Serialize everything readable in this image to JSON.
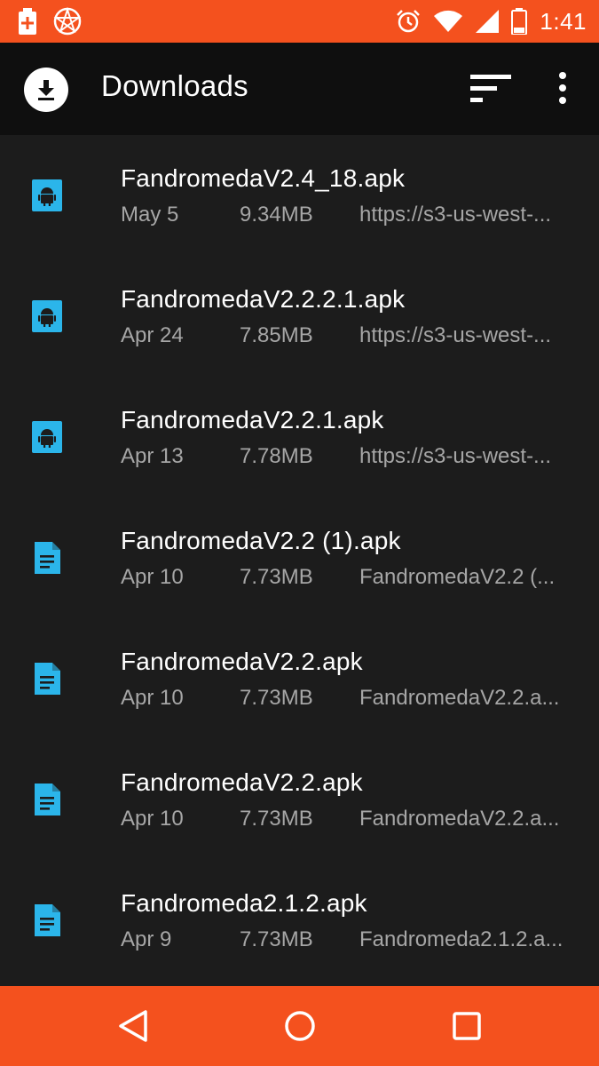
{
  "status_bar": {
    "time": "1:41",
    "icons": [
      "medical-kit-icon",
      "pentagram-icon",
      "alarm-icon",
      "wifi-icon",
      "signal-icon",
      "battery-icon"
    ],
    "color": "#f4511e"
  },
  "app_bar": {
    "title": "Downloads",
    "icon": "download-icon",
    "actions": [
      "sort-icon",
      "more-vert-icon"
    ]
  },
  "downloads": [
    {
      "name": "FandromedaV2.4_18.apk",
      "date": "May 5",
      "size": "9.34MB",
      "source": "https://s3-us-west-...",
      "icon": "android-icon"
    },
    {
      "name": "FandromedaV2.2.2.1.apk",
      "date": "Apr 24",
      "size": "7.85MB",
      "source": "https://s3-us-west-...",
      "icon": "android-icon"
    },
    {
      "name": "FandromedaV2.2.1.apk",
      "date": "Apr 13",
      "size": "7.78MB",
      "source": "https://s3-us-west-...",
      "icon": "android-icon"
    },
    {
      "name": "FandromedaV2.2 (1).apk",
      "date": "Apr 10",
      "size": "7.73MB",
      "source": "FandromedaV2.2 (...",
      "icon": "document-icon"
    },
    {
      "name": "FandromedaV2.2.apk",
      "date": "Apr 10",
      "size": "7.73MB",
      "source": "FandromedaV2.2.a...",
      "icon": "document-icon"
    },
    {
      "name": "FandromedaV2.2.apk",
      "date": "Apr 10",
      "size": "7.73MB",
      "source": "FandromedaV2.2.a...",
      "icon": "document-icon"
    },
    {
      "name": "Fandromeda2.1.2.apk",
      "date": "Apr 9",
      "size": "7.73MB",
      "source": "Fandromeda2.1.2.a...",
      "icon": "document-icon"
    }
  ],
  "nav_bar": {
    "buttons": [
      "back-icon",
      "home-icon",
      "recents-icon"
    ]
  },
  "colors": {
    "accent": "#f4511e",
    "icon_blue": "#2bb5ea",
    "background": "#1c1c1c",
    "app_bar": "#0f0f0f"
  }
}
